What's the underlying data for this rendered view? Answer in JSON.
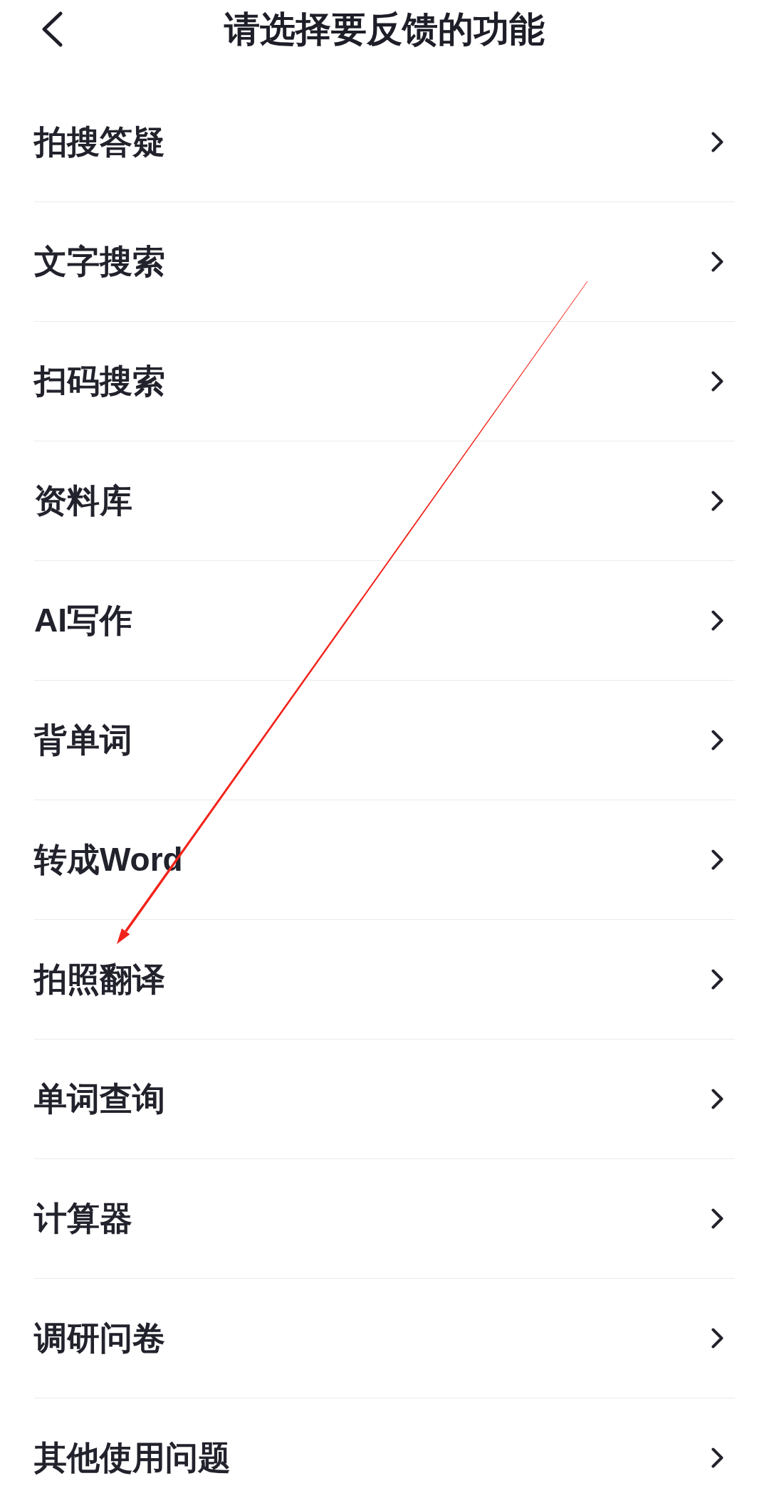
{
  "header": {
    "title": "请选择要反馈的功能"
  },
  "items": [
    {
      "label": "拍搜答疑"
    },
    {
      "label": "文字搜索"
    },
    {
      "label": "扫码搜索"
    },
    {
      "label": "资料库"
    },
    {
      "label": "AI写作"
    },
    {
      "label": "背单词"
    },
    {
      "label": "转成Word"
    },
    {
      "label": "拍照翻译"
    },
    {
      "label": "单词查询"
    },
    {
      "label": "计算器"
    },
    {
      "label": "调研问卷"
    },
    {
      "label": "其他使用问题"
    }
  ]
}
